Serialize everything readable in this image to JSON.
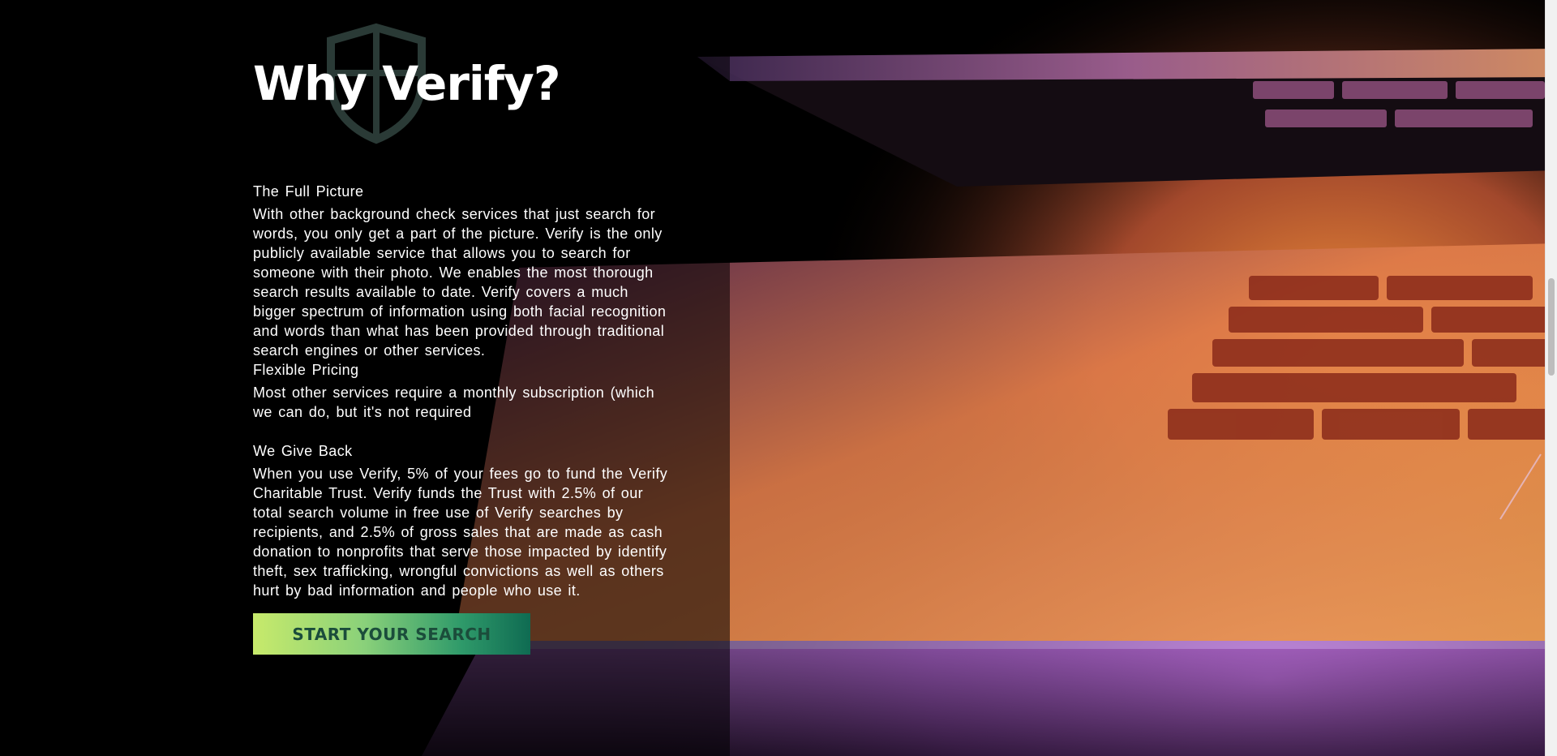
{
  "hero": {
    "heading": "Why Verify?",
    "shield_icon": "shield-icon"
  },
  "sections": [
    {
      "title": "The Full Picture",
      "body": "With other background check services that just search for words, you only get a part of the picture. Verify is the only publicly available service that allows you to search for someone with their photo. We enables the most thorough search results available to date. Verify covers a much bigger spectrum of information using both facial recognition and words than what has been provided through traditional search engines or other services."
    },
    {
      "title": "Flexible Pricing",
      "body": "Most other services require a monthly subscription (which we can do, but it's not required"
    },
    {
      "title": "We Give Back",
      "body": "When you use Verify, 5% of your fees go to fund the Verify Charitable Trust. Verify funds the Trust with 2.5% of our total search volume in free use of Verify searches by recipients, and 2.5% of gross sales that are made as cash donation to nonprofits that serve those impacted by identify theft, sex trafficking, wrongful convictions as well as others hurt by bad information and people who use it."
    }
  ],
  "cta": {
    "label": "START YOUR SEARCH"
  },
  "colors": {
    "background": "#000000",
    "text": "#ffffff",
    "cta_gradient_start": "#c7ea6b",
    "cta_gradient_end": "#0f6b52",
    "cta_text": "#1b4d3b",
    "shield_stroke": "#2a3a36"
  }
}
